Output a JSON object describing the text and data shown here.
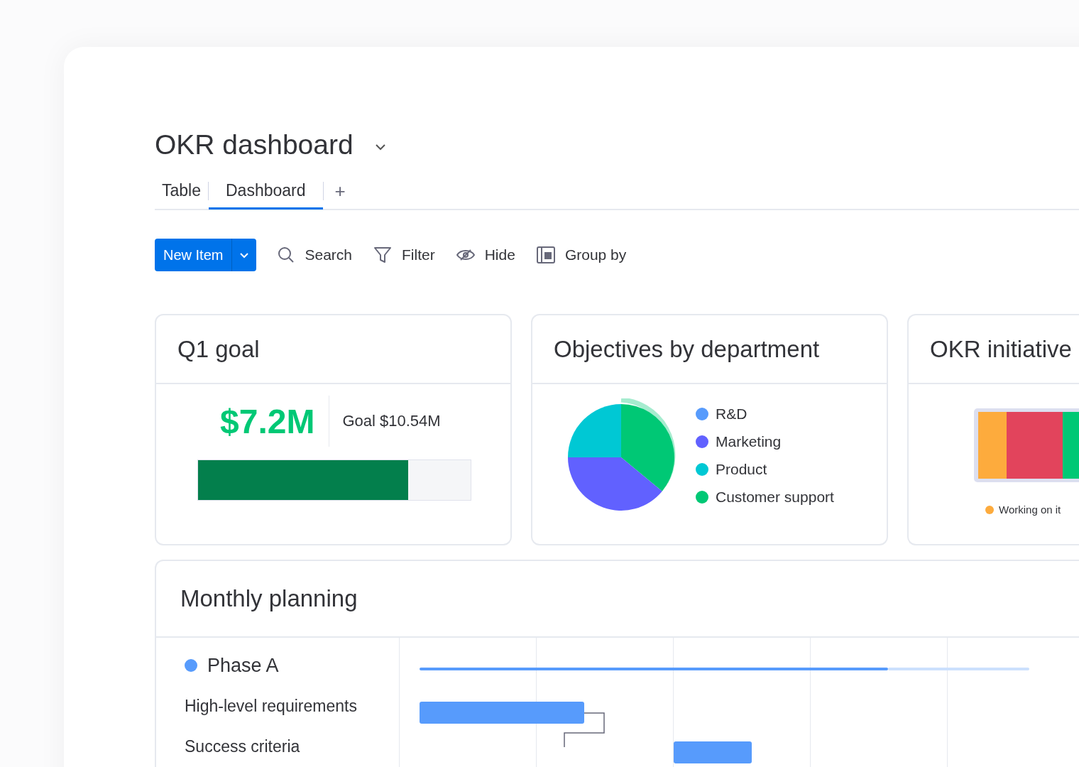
{
  "board": {
    "title": "OKR dashboard"
  },
  "tabs": [
    {
      "label": "Table",
      "selected": false
    },
    {
      "label": "Dashboard",
      "selected": true
    }
  ],
  "add_tab": "+",
  "toolbar": {
    "new_item": "New Item",
    "actions": [
      {
        "kind": "search",
        "label": "Search"
      },
      {
        "kind": "filter",
        "label": "Filter"
      },
      {
        "kind": "hide",
        "label": "Hide"
      },
      {
        "kind": "group",
        "label": "Group by"
      }
    ]
  },
  "goal_widget": {
    "title": "Q1 goal",
    "value": "$7.2M",
    "goal": "Goal $10.54M",
    "level": 0.77
  },
  "department_widget": {
    "title": "Objectives by department",
    "legend": [
      {
        "label": "R&D",
        "color": "#579bfc"
      },
      {
        "label": "Marketing",
        "color": "#6161ff"
      },
      {
        "label": "Product",
        "color": "#00c8d4"
      },
      {
        "label": "Customer support",
        "color": "#00c875"
      }
    ]
  },
  "initiatives_widget": {
    "title": "OKR initiative",
    "legend": [
      {
        "label": "Working on it",
        "color": "#fdab3d"
      }
    ]
  },
  "planning_widget": {
    "title": "Monthly planning",
    "rows": [
      {
        "kind": "group",
        "label": "Phase A",
        "color": "#579bfc"
      },
      {
        "kind": "task",
        "label": "High-level requirements"
      },
      {
        "kind": "task",
        "label": "Success criteria"
      }
    ]
  }
}
